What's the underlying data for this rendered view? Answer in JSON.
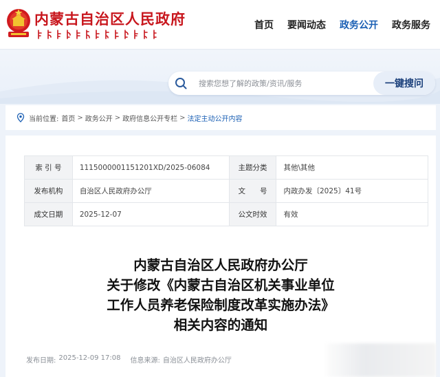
{
  "header": {
    "site_title": "内蒙古自治区人民政府",
    "nav": [
      {
        "label": "首页",
        "active": false
      },
      {
        "label": "要闻动态",
        "active": false
      },
      {
        "label": "政务公开",
        "active": true
      },
      {
        "label": "政务服务",
        "active": false
      }
    ]
  },
  "search": {
    "placeholder": "搜索您想了解的政策/资讯/服务",
    "button_label": "一键搜问"
  },
  "breadcrumb": {
    "prefix": "当前位置:",
    "items": [
      "首页",
      "政务公开",
      "政府信息公开专栏",
      "法定主动公开内容"
    ],
    "separator": ">"
  },
  "meta": {
    "rows": [
      [
        {
          "label": "索 引 号",
          "value": "1115000001151201XD/2025-06084"
        },
        {
          "label": "主题分类",
          "value": "其他\\其他"
        }
      ],
      [
        {
          "label": "发布机构",
          "value": "自治区人民政府办公厅"
        },
        {
          "label": "文　　号",
          "value": "内政办发〔2025〕41号"
        }
      ],
      [
        {
          "label": "成文日期",
          "value": "2025-12-07"
        },
        {
          "label": "公文时效",
          "value": "有效"
        }
      ]
    ]
  },
  "document": {
    "title_lines": [
      "内蒙古自治区人民政府办公厅",
      "关于修改《内蒙古自治区机关事业单位",
      "工作人员养老保险制度改革实施办法》",
      "相关内容的通知"
    ],
    "publish_date_label": "发布日期:",
    "publish_date": "2025-12-09 17:08",
    "source_label": "信息来源:",
    "source": "自治区人民政府办公厅"
  },
  "colors": {
    "brand_red": "#c8161d",
    "accent_blue": "#1a5fb4",
    "background": "#eef3fa"
  }
}
